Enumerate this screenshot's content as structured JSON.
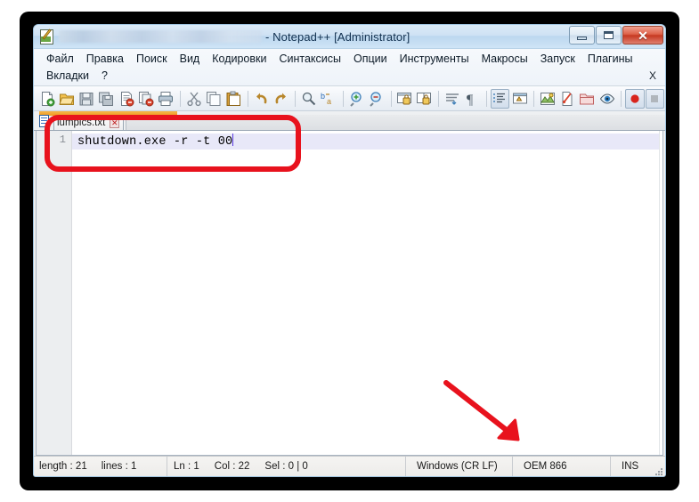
{
  "window": {
    "title_suffix": "- Notepad++ [Administrator]",
    "title_blurred": true,
    "app_icon": "notepad-plus-plus-icon",
    "controls": {
      "minimize": "minimize-button",
      "maximize": "restore-button",
      "close_glyph": "✕"
    }
  },
  "menu": {
    "row1": [
      "Файл",
      "Правка",
      "Поиск",
      "Вид",
      "Кодировки",
      "Синтаксисы",
      "Опции",
      "Инструменты",
      "Макросы",
      "Запуск",
      "Плагины"
    ],
    "row2": [
      "Вкладки",
      "?"
    ],
    "close_x": "X"
  },
  "toolbar": {
    "groups": [
      [
        "new-file-icon",
        "open-file-icon",
        "save-icon",
        "save-all-icon",
        "close-file-icon",
        "close-all-icon",
        "print-icon"
      ],
      [
        "cut-icon",
        "copy-icon",
        "paste-icon"
      ],
      [
        "undo-icon",
        "redo-icon"
      ],
      [
        "find-icon",
        "replace-icon"
      ],
      [
        "zoom-in-icon",
        "zoom-out-icon"
      ],
      [
        "sync-vertical-scroll-icon",
        "sync-horizontal-scroll-icon"
      ],
      [
        "word-wrap-icon",
        "show-all-chars-icon"
      ],
      [
        "indent-guide-icon",
        "user-defined-dialog-icon"
      ],
      [
        "show-document-map-icon",
        "function-list-icon",
        "folder-as-workspace-icon",
        "monitoring-icon"
      ],
      [
        "record-macro-icon",
        "stop-macro-icon"
      ]
    ]
  },
  "tabs": {
    "active_index": 0,
    "items": [
      {
        "label": "lumpics.txt",
        "close_glyph": "✕",
        "icon": "text-document-icon"
      }
    ]
  },
  "editor": {
    "line_numbers": [
      "1"
    ],
    "lines": [
      "shutdown.exe -r -t 00"
    ],
    "caret_visible": true
  },
  "statusbar": {
    "length_label": "length : 21",
    "lines_label": "lines : 1",
    "ln_label": "Ln : 1",
    "col_label": "Col : 22",
    "sel_label": "Sel : 0 | 0",
    "eol_label": "Windows (CR LF)",
    "encoding_label": "OEM 866",
    "insert_mode_label": "INS"
  },
  "annotations": {
    "highlight_rect": "red-rounded-rectangle-around-command-line",
    "arrow": "red-arrow-pointing-to-encoding",
    "color": "#e8121d"
  }
}
